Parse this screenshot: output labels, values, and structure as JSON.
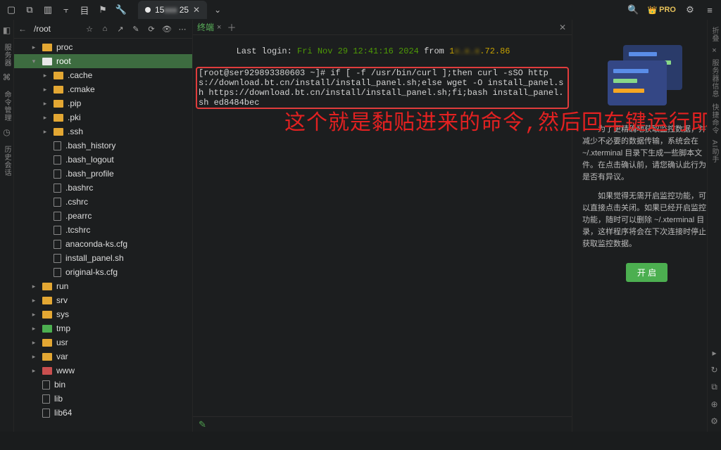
{
  "titlebar": {
    "tab_label_prefix": "15",
    "tab_label_blur": "xxx",
    "tab_label_suffix": " 25",
    "icons": {
      "search": "🔍",
      "pro": "PRO",
      "gear": "⚙",
      "help": "≡"
    }
  },
  "left_rail": {
    "label1": "服务器",
    "label2": "命令管理",
    "label3": "历史会话"
  },
  "sidebar": {
    "path": "/root",
    "items": [
      {
        "caret": "▸",
        "cls": "indent1",
        "icon": "folder",
        "name": "proc"
      },
      {
        "caret": "▾",
        "cls": "indent1 selected",
        "icon": "folder sel",
        "name": "root"
      },
      {
        "caret": "▸",
        "cls": "indent2",
        "icon": "folder",
        "name": ".cache"
      },
      {
        "caret": "▸",
        "cls": "indent2",
        "icon": "folder",
        "name": ".cmake"
      },
      {
        "caret": "▸",
        "cls": "indent2",
        "icon": "folder",
        "name": ".pip"
      },
      {
        "caret": "▸",
        "cls": "indent2",
        "icon": "folder",
        "name": ".pki"
      },
      {
        "caret": "▸",
        "cls": "indent2",
        "icon": "folder",
        "name": ".ssh"
      },
      {
        "caret": "",
        "cls": "indent2",
        "icon": "file",
        "name": ".bash_history"
      },
      {
        "caret": "",
        "cls": "indent2",
        "icon": "file",
        "name": ".bash_logout"
      },
      {
        "caret": "",
        "cls": "indent2",
        "icon": "file",
        "name": ".bash_profile"
      },
      {
        "caret": "",
        "cls": "indent2",
        "icon": "file",
        "name": ".bashrc"
      },
      {
        "caret": "",
        "cls": "indent2",
        "icon": "file",
        "name": ".cshrc"
      },
      {
        "caret": "",
        "cls": "indent2",
        "icon": "file",
        "name": ".pearrc"
      },
      {
        "caret": "",
        "cls": "indent2",
        "icon": "file",
        "name": ".tcshrc"
      },
      {
        "caret": "",
        "cls": "indent2",
        "icon": "file gear",
        "name": "anaconda-ks.cfg"
      },
      {
        "caret": "",
        "cls": "indent2",
        "icon": "file",
        "name": "install_panel.sh"
      },
      {
        "caret": "",
        "cls": "indent2",
        "icon": "file gear",
        "name": "original-ks.cfg"
      },
      {
        "caret": "▸",
        "cls": "indent1",
        "icon": "folder",
        "name": "run"
      },
      {
        "caret": "▸",
        "cls": "indent1",
        "icon": "folder",
        "name": "srv"
      },
      {
        "caret": "▸",
        "cls": "indent1",
        "icon": "folder",
        "name": "sys"
      },
      {
        "caret": "▸",
        "cls": "indent1",
        "icon": "folder green",
        "name": "tmp"
      },
      {
        "caret": "▸",
        "cls": "indent1",
        "icon": "folder",
        "name": "usr"
      },
      {
        "caret": "▸",
        "cls": "indent1",
        "icon": "folder",
        "name": "var"
      },
      {
        "caret": "▸",
        "cls": "indent1",
        "icon": "folder red",
        "name": "www"
      },
      {
        "caret": "",
        "cls": "indent1",
        "icon": "file",
        "name": "bin"
      },
      {
        "caret": "",
        "cls": "indent1",
        "icon": "file",
        "name": "lib"
      },
      {
        "caret": "",
        "cls": "indent1",
        "icon": "file",
        "name": "lib64"
      }
    ]
  },
  "terminal": {
    "tab": "终端",
    "login_prefix": "Last login:",
    "login_date": " Fri Nov 29 12:41:16 2024 ",
    "login_from": "from ",
    "login_ip_shown": "1",
    "login_ip_blur": "x.x.x",
    "login_ip_end": ".72.86",
    "cmd": "[root@ser929893380603 ~]# if [ -f /usr/bin/curl ];then curl -sSO https://download.bt.cn/install/install_panel.sh;else wget -O install_panel.sh https://download.bt.cn/install/install_panel.sh;fi;bash install_panel.sh ed8484bec",
    "overlay": "这个就是黏贴进来的命令,然后回车键运行即可",
    "footer_icon": "✎"
  },
  "rightpane": {
    "para1": "　　为了更精确地获取监控数据，并减少不必要的数据传输，系统会在 ~/.xterminal 目录下生成一些脚本文件。在点击确认前，请您确认此行为是否有异议。",
    "para2": "　　如果觉得无需开启监控功能，可以直接点击关闭。如果已经开启监控功能，随时可以删除 ~/.xterminal 目录，这样程序将会在下次连接时停止获取监控数据。",
    "button": "开 启"
  },
  "right_rail": {
    "l1": "折叠",
    "l2": "服务器信息",
    "l3": "快捷命令",
    "l4": "AI助手"
  }
}
